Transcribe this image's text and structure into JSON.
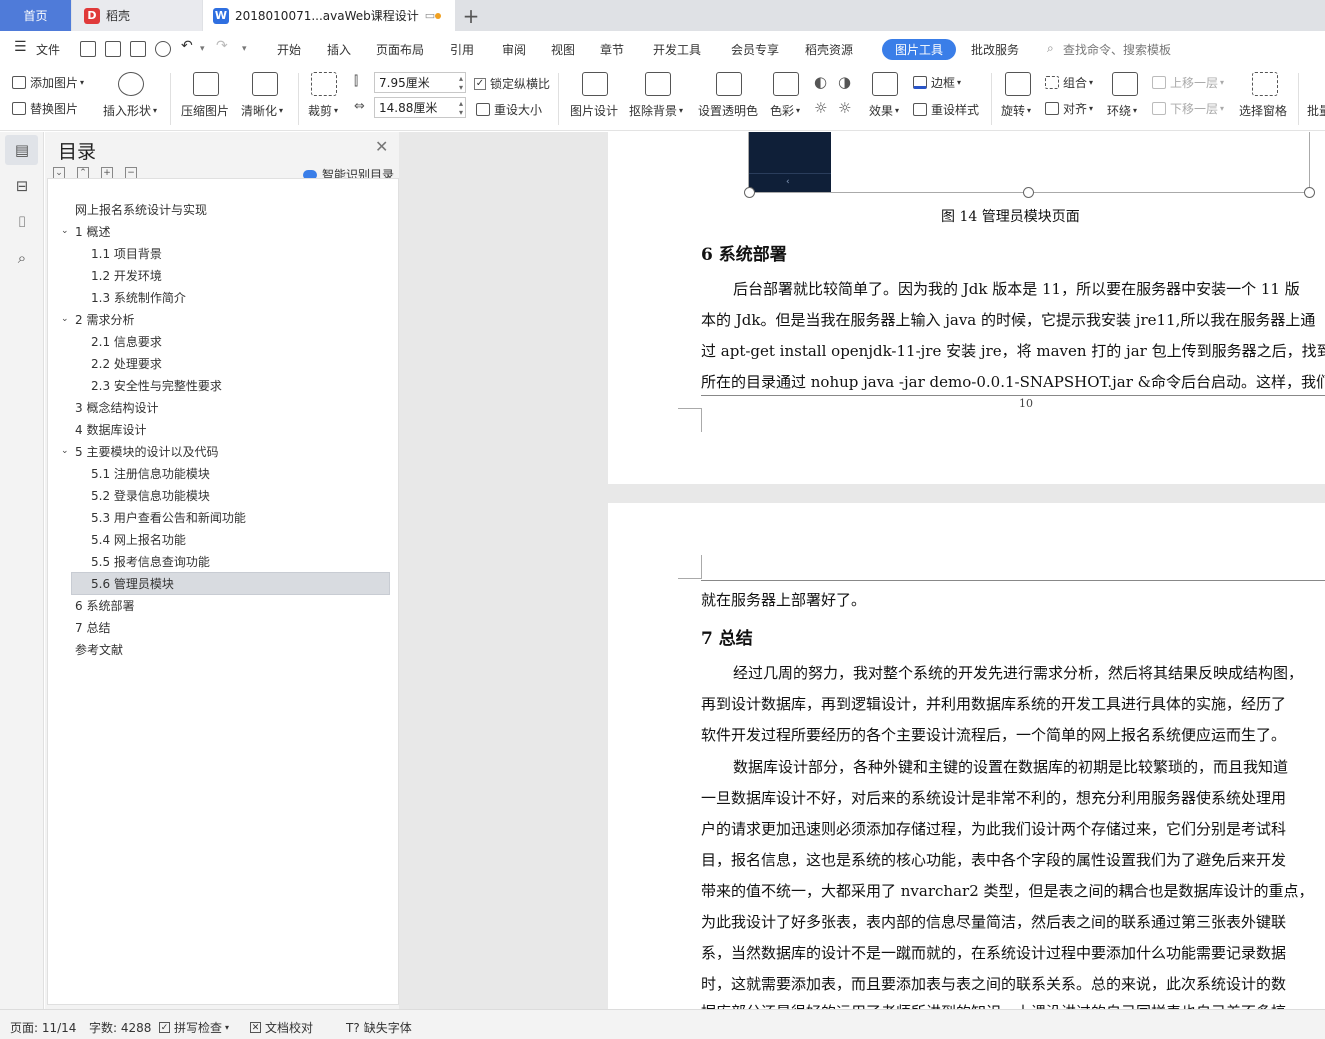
{
  "tabs": {
    "home": "首页",
    "daoke": "稻壳",
    "doc": "2018010071...avaWeb课程设计"
  },
  "menu": {
    "file": "文件",
    "items": [
      "开始",
      "插入",
      "页面布局",
      "引用",
      "审阅",
      "视图",
      "章节",
      "开发工具",
      "会员专享",
      "稻壳资源"
    ],
    "active": "图片工具",
    "review": "批改服务",
    "search_placeholder": "查找命令、搜索模板"
  },
  "ribbon": {
    "add_picture": "添加图片",
    "replace_picture": "替换图片",
    "insert_shape": "插入形状",
    "compress": "压缩图片",
    "sharpen": "清晰化",
    "crop": "裁剪",
    "width": "7.95厘米",
    "height": "14.88厘米",
    "lock_ratio": "锁定纵横比",
    "reset_size": "重设大小",
    "pic_design": "图片设计",
    "remove_bg": "抠除背景",
    "set_transparent": "设置透明色",
    "color": "色彩",
    "effect": "效果",
    "border": "边框",
    "reset_style": "重设样式",
    "rotate": "旋转",
    "group": "组合",
    "align": "对齐",
    "wrap": "环绕",
    "bring_forward": "上移一层",
    "send_backward": "下移一层",
    "selection_pane": "选择窗格",
    "batch": "批量"
  },
  "toc": {
    "title": "目录",
    "smart": "智能识别目录",
    "items": [
      {
        "label": "网上报名系统设计与实现",
        "level": 0,
        "arrow": ""
      },
      {
        "label": "1  概述",
        "level": 0,
        "arrow": "⌄"
      },
      {
        "label": "1.1  项目背景",
        "level": 1,
        "arrow": ""
      },
      {
        "label": "1.2  开发环境",
        "level": 1,
        "arrow": ""
      },
      {
        "label": "1.3  系统制作简介",
        "level": 1,
        "arrow": ""
      },
      {
        "label": "2  需求分析",
        "level": 0,
        "arrow": "⌄"
      },
      {
        "label": "2.1  信息要求",
        "level": 1,
        "arrow": ""
      },
      {
        "label": "2.2  处理要求",
        "level": 1,
        "arrow": ""
      },
      {
        "label": "2.3  安全性与完整性要求",
        "level": 1,
        "arrow": ""
      },
      {
        "label": "3  概念结构设计",
        "level": 0,
        "arrow": ""
      },
      {
        "label": "4  数据库设计",
        "level": 0,
        "arrow": ""
      },
      {
        "label": "5  主要模块的设计以及代码",
        "level": 0,
        "arrow": "⌄"
      },
      {
        "label": "5.1  注册信息功能模块",
        "level": 1,
        "arrow": ""
      },
      {
        "label": "5.2  登录信息功能模块",
        "level": 1,
        "arrow": ""
      },
      {
        "label": "5.3  用户查看公告和新闻功能",
        "level": 1,
        "arrow": ""
      },
      {
        "label": "5.4  网上报名功能",
        "level": 1,
        "arrow": ""
      },
      {
        "label": "5.5  报考信息查询功能",
        "level": 1,
        "arrow": ""
      },
      {
        "label": "5.6  管理员模块",
        "level": 1,
        "arrow": ""
      },
      {
        "label": "6  系统部署",
        "level": 0,
        "arrow": ""
      },
      {
        "label": "7  总结",
        "level": 0,
        "arrow": ""
      },
      {
        "label": "参考文献",
        "level": 0,
        "arrow": ""
      }
    ]
  },
  "doc": {
    "figure_caption": "图 14    管理员模块页面",
    "h6": "6  系统部署",
    "p6": [
      "后台部署就比较简单了。因为我的 Jdk 版本是 11，所以要在服务器中安装一个 11 版",
      "本的 Jdk。但是当我在服务器上输入 java 的时候，它提示我安装 jre11,所以我在服务器上通",
      "过 apt-get install openjdk-11-jre 安装 jre，将 maven 打的 jar 包上传到服务器之后，找到 jar",
      "所在的目录通过 nohup java -jar demo-0.0.1-SNAPSHOT.jar &命令后台启动。这样，我们的"
    ],
    "page_number": "10",
    "p6_cont": "就在服务器上部署好了。",
    "h7": "7  总结",
    "p7": [
      "经过几周的努力，我对整个系统的开发先进行需求分析，然后将其结果反映成结构图，",
      "再到设计数据库，再到逻辑设计，并利用数据库系统的开发工具进行具体的实施，经历了",
      "软件开发过程所要经历的各个主要设计流程后，一个简单的网上报名系统便应运而生了。",
      "数据库设计部分，各种外键和主键的设置在数据库的初期是比较繁琐的，而且我知道",
      "一旦数据库设计不好，对后来的系统设计是非常不利的，想充分利用服务器使系统处理用",
      "户的请求更加迅速则必须添加存储过程，为此我们设计两个存储过来，它们分别是考试科",
      "目，报名信息，这也是系统的核心功能，表中各个字段的属性设置我们为了避免后来开发",
      "带来的值不统一，大都采用了 nvarchar2 类型，但是表之间的耦合也是数据库设计的重点，",
      "为此我设计了好多张表，表内部的信息尽量简洁，然后表之间的联系通过第三张表外键联",
      "系，当然数据库的设计不是一蹴而就的，在系统设计过程中要添加什么功能需要记录数据",
      "时，这就需要添加表，而且要添加表与表之间的联系关系。总的来说，此次系统设计的数",
      "据库部分还是很好的运用了老师所讲到的知识，上课没讲过的自己同样表也自己差不多搞"
    ]
  },
  "status": {
    "page": "页面: 11/14",
    "words": "字数: 4288",
    "spell": "拼写检查",
    "proof": "文档校对",
    "missing_font": "缺失字体"
  }
}
